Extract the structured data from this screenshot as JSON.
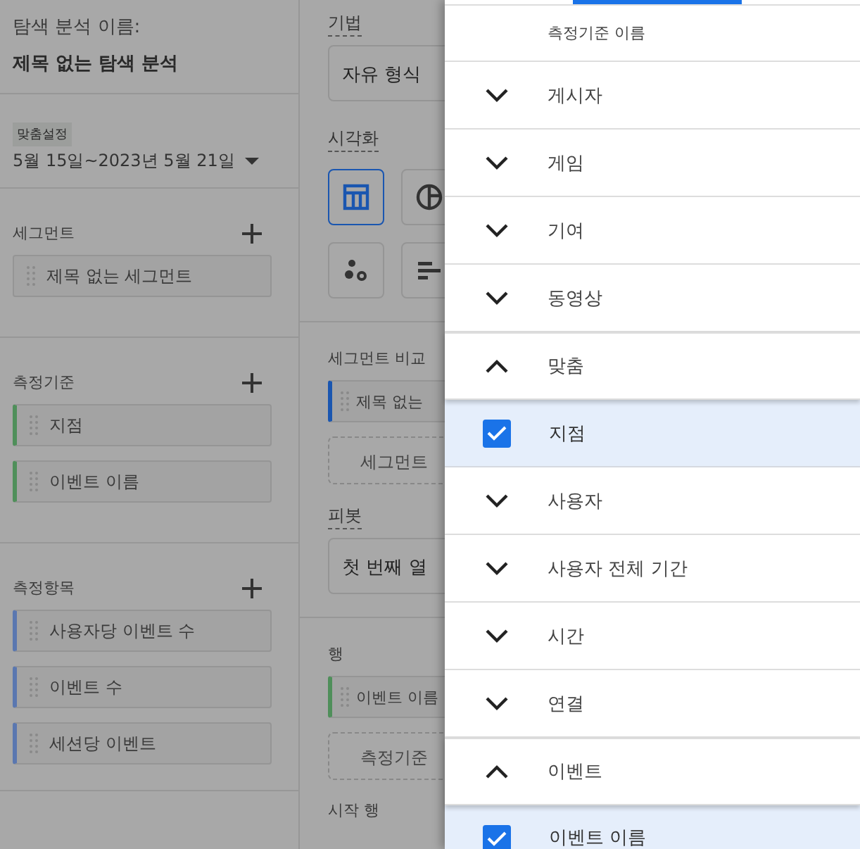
{
  "exploration": {
    "label": "탐색 분석 이름:",
    "title": "제목 없는 탐색 분석"
  },
  "date_range": {
    "badge": "맞춤설정",
    "value": "5월 15일~2023년 5월 21일"
  },
  "sections": [
    {
      "title": "세그먼트",
      "items": [
        {
          "label": "제목 없는 세그먼트",
          "kind": "segment"
        }
      ]
    },
    {
      "title": "측정기준",
      "items": [
        {
          "label": "지점",
          "kind": "dimension"
        },
        {
          "label": "이벤트 이름",
          "kind": "dimension"
        }
      ]
    },
    {
      "title": "측정항목",
      "items": [
        {
          "label": "사용자당 이벤트 수",
          "kind": "metric"
        },
        {
          "label": "이벤트 수",
          "kind": "metric"
        },
        {
          "label": "세션당 이벤트",
          "kind": "metric"
        }
      ]
    }
  ],
  "settings": {
    "technique_label": "기법",
    "technique": "자유 형식",
    "visualization_label": "시각화",
    "visualizations": [
      {
        "kind": "table",
        "selected": true
      },
      {
        "kind": "pie",
        "selected": false
      },
      {
        "kind": "scatter",
        "selected": false
      },
      {
        "kind": "bar",
        "selected": false
      }
    ],
    "segment_compare_label": "세그먼트 비교",
    "segment_compare_chip": "제목 없는",
    "segment_drop": "세그먼트",
    "pivot_label": "피봇",
    "pivot": "첫 번째 열",
    "rows_label": "행",
    "rows_chip": "이벤트 이름",
    "rows_drop": "측정기준",
    "start_row_label": "시작 행"
  },
  "panel": {
    "header": "측정기준 이름",
    "groups": [
      {
        "label": "게시자",
        "expanded": false
      },
      {
        "label": "게임",
        "expanded": false
      },
      {
        "label": "기여",
        "expanded": false
      },
      {
        "label": "동영상",
        "expanded": false
      },
      {
        "label": "맞춤",
        "expanded": true,
        "children": [
          {
            "label": "지점",
            "checked": true
          }
        ]
      },
      {
        "label": "사용자",
        "expanded": false
      },
      {
        "label": "사용자 전체 기간",
        "expanded": false
      },
      {
        "label": "시간",
        "expanded": false
      },
      {
        "label": "연결",
        "expanded": false
      },
      {
        "label": "이벤트",
        "expanded": true,
        "children": [
          {
            "label": "이벤트 이름",
            "checked": true
          }
        ]
      }
    ]
  }
}
